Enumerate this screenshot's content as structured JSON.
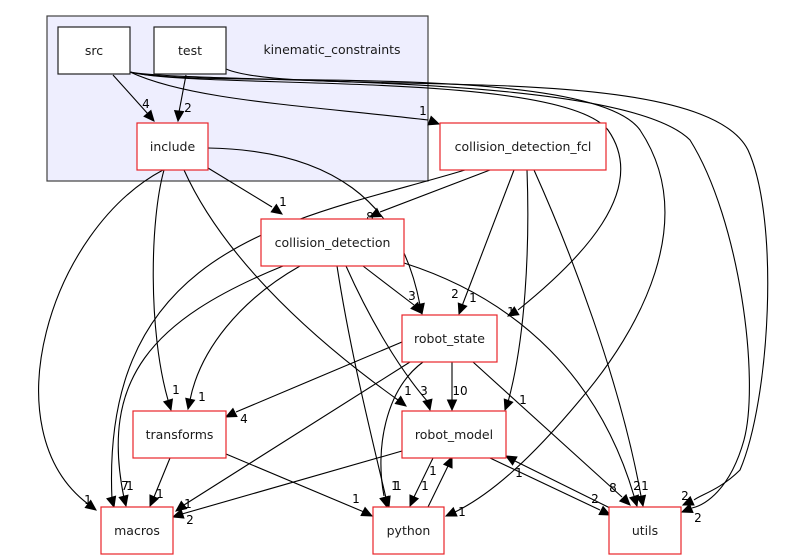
{
  "cluster": {
    "label": "kinematic_constraints",
    "children": [
      "src",
      "test",
      "include"
    ]
  },
  "nodes": [
    {
      "id": "src",
      "label": "src",
      "style": "local"
    },
    {
      "id": "test",
      "label": "test",
      "style": "local"
    },
    {
      "id": "include",
      "label": "include",
      "style": "dir"
    },
    {
      "id": "collision_detection_fcl",
      "label": "collision_detection_fcl",
      "style": "dir"
    },
    {
      "id": "collision_detection",
      "label": "collision_detection",
      "style": "dir"
    },
    {
      "id": "robot_state",
      "label": "robot_state",
      "style": "dir"
    },
    {
      "id": "transforms",
      "label": "transforms",
      "style": "dir"
    },
    {
      "id": "robot_model",
      "label": "robot_model",
      "style": "dir"
    },
    {
      "id": "macros",
      "label": "macros",
      "style": "dir"
    },
    {
      "id": "python",
      "label": "python",
      "style": "dir"
    },
    {
      "id": "utils",
      "label": "utils",
      "style": "dir"
    }
  ],
  "edges": [
    {
      "from": "src",
      "to": "include",
      "label": "4"
    },
    {
      "from": "test",
      "to": "include",
      "label": "2"
    },
    {
      "from": "src",
      "to": "collision_detection_fcl",
      "label": "1"
    },
    {
      "from": "src",
      "to": "robot_state",
      "label": "1"
    },
    {
      "from": "src",
      "to": "utils",
      "label": "2"
    },
    {
      "from": "src",
      "to": "python",
      "label": "1"
    },
    {
      "from": "test",
      "to": "utils",
      "label": "2"
    },
    {
      "from": "include",
      "to": "collision_detection",
      "label": "1"
    },
    {
      "from": "include",
      "to": "robot_state",
      "label": "2"
    },
    {
      "from": "include",
      "to": "transforms",
      "label": "1"
    },
    {
      "from": "include",
      "to": "robot_model",
      "label": "1"
    },
    {
      "from": "include",
      "to": "macros",
      "label": "1"
    },
    {
      "from": "collision_detection_fcl",
      "to": "collision_detection",
      "label": "8"
    },
    {
      "from": "collision_detection_fcl",
      "to": "robot_state",
      "label": "1"
    },
    {
      "from": "collision_detection_fcl",
      "to": "robot_model",
      "label": "1"
    },
    {
      "from": "collision_detection_fcl",
      "to": "utils",
      "label": "1"
    },
    {
      "from": "collision_detection_fcl",
      "to": "macros",
      "label": "7"
    },
    {
      "from": "collision_detection",
      "to": "robot_state",
      "label": "3"
    },
    {
      "from": "collision_detection",
      "to": "transforms",
      "label": "1"
    },
    {
      "from": "collision_detection",
      "to": "robot_model",
      "label": "3"
    },
    {
      "from": "collision_detection",
      "to": "python",
      "label": "1"
    },
    {
      "from": "collision_detection",
      "to": "utils",
      "label": "2"
    },
    {
      "from": "collision_detection",
      "to": "macros",
      "label": "1"
    },
    {
      "from": "robot_state",
      "to": "robot_model",
      "label": "10"
    },
    {
      "from": "robot_state",
      "to": "transforms",
      "label": "4"
    },
    {
      "from": "robot_state",
      "to": "python",
      "label": "1"
    },
    {
      "from": "robot_state",
      "to": "macros",
      "label": "1"
    },
    {
      "from": "robot_state",
      "to": "utils",
      "label": "8"
    },
    {
      "from": "transforms",
      "to": "macros",
      "label": "1"
    },
    {
      "from": "transforms",
      "to": "python",
      "label": "1"
    },
    {
      "from": "robot_model",
      "to": "python",
      "label": "1"
    },
    {
      "from": "robot_model",
      "to": "macros",
      "label": "2"
    },
    {
      "from": "robot_model",
      "to": "utils",
      "label": "2"
    },
    {
      "from": "python",
      "to": "robot_model",
      "label": "1"
    },
    {
      "from": "utils",
      "to": "robot_model",
      "label": "1"
    }
  ]
}
